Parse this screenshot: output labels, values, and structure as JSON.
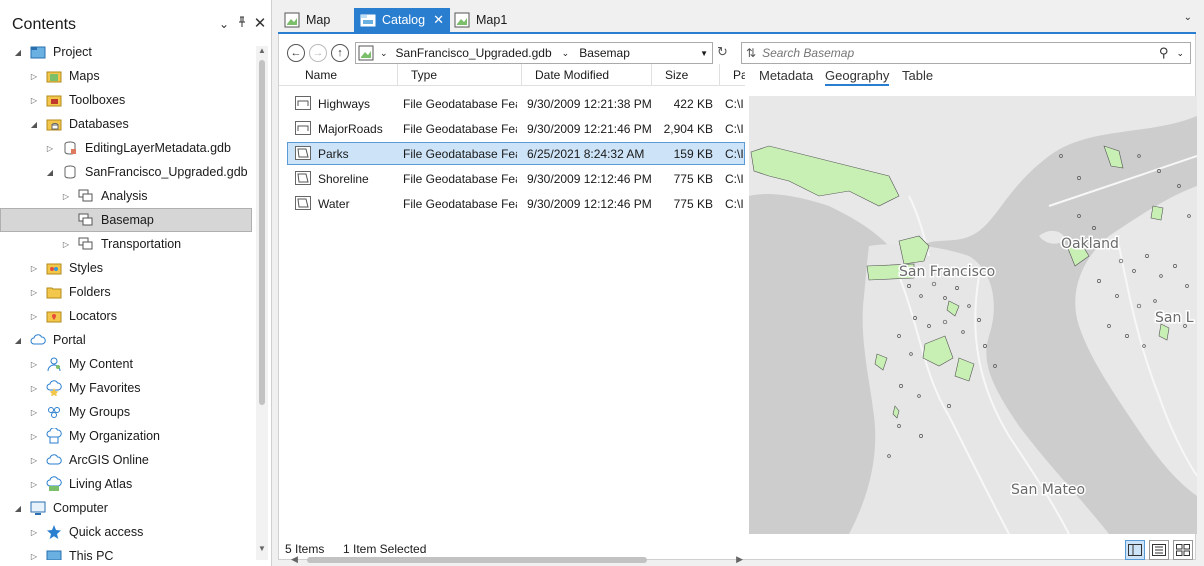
{
  "contents": {
    "title": "Contents",
    "items": [
      {
        "label": "Project",
        "icon": "project-icon"
      },
      {
        "label": "Maps",
        "icon": "maps-folder-icon"
      },
      {
        "label": "Toolboxes",
        "icon": "toolbox-icon"
      },
      {
        "label": "Databases",
        "icon": "database-folder-icon"
      },
      {
        "label": "EditingLayerMetadata.gdb",
        "icon": "geodatabase-icon"
      },
      {
        "label": "SanFrancisco_Upgraded.gdb",
        "icon": "geodatabase-icon"
      },
      {
        "label": "Analysis",
        "icon": "feature-dataset-icon"
      },
      {
        "label": "Basemap",
        "icon": "feature-dataset-icon"
      },
      {
        "label": "Transportation",
        "icon": "feature-dataset-icon"
      },
      {
        "label": "Styles",
        "icon": "styles-icon"
      },
      {
        "label": "Folders",
        "icon": "folder-icon"
      },
      {
        "label": "Locators",
        "icon": "locator-icon"
      },
      {
        "label": "Portal",
        "icon": "cloud-icon"
      },
      {
        "label": "My Content",
        "icon": "my-content-icon"
      },
      {
        "label": "My Favorites",
        "icon": "star-icon"
      },
      {
        "label": "My Groups",
        "icon": "groups-icon"
      },
      {
        "label": "My Organization",
        "icon": "organization-icon"
      },
      {
        "label": "ArcGIS Online",
        "icon": "cloud-icon"
      },
      {
        "label": "Living Atlas",
        "icon": "living-atlas-icon"
      },
      {
        "label": "Computer",
        "icon": "computer-icon"
      },
      {
        "label": "Quick access",
        "icon": "pin-star-icon"
      },
      {
        "label": "This PC",
        "icon": "this-pc-icon"
      }
    ]
  },
  "tabs": [
    {
      "label": "Map"
    },
    {
      "label": "Catalog"
    },
    {
      "label": "Map1"
    }
  ],
  "catalog": {
    "path": {
      "gdb": "SanFrancisco_Upgraded.gdb",
      "dataset": "Basemap"
    },
    "search_placeholder": "Search Basemap",
    "columns": [
      "Name",
      "Type",
      "Date Modified",
      "Size",
      "Pa"
    ],
    "rows": [
      {
        "name": "Highways",
        "type": "File Geodatabase Feat",
        "date": "9/30/2009 12:21:38 PM",
        "size": "422 KB",
        "path": "C:\\I",
        "icon": "line-feature-class-icon"
      },
      {
        "name": "MajorRoads",
        "type": "File Geodatabase Feat",
        "date": "9/30/2009 12:21:46 PM",
        "size": "2,904 KB",
        "path": "C:\\I",
        "icon": "line-feature-class-icon"
      },
      {
        "name": "Parks",
        "type": "File Geodatabase Feat",
        "date": "6/25/2021 8:24:32 AM",
        "size": "159 KB",
        "path": "C:\\I",
        "icon": "polygon-feature-class-icon"
      },
      {
        "name": "Shoreline",
        "type": "File Geodatabase Feat",
        "date": "9/30/2009 12:12:46 PM",
        "size": "775 KB",
        "path": "C:\\I",
        "icon": "polygon-feature-class-icon"
      },
      {
        "name": "Water",
        "type": "File Geodatabase Feat",
        "date": "9/30/2009 12:12:46 PM",
        "size": "775 KB",
        "path": "C:\\I",
        "icon": "polygon-feature-class-icon"
      }
    ],
    "status": {
      "items": "5 Items",
      "selected": "1 Item Selected"
    },
    "preview_tabs": [
      "Metadata",
      "Geography",
      "Table"
    ],
    "map_labels": {
      "sf": "San Francisco",
      "oakland": "Oakland",
      "san_mateo": "San Mateo",
      "san_l": "San L"
    }
  },
  "colors": {
    "accent": "#2a7ecf",
    "selection": "#cde3f7",
    "park_fill": "#c8f0b4",
    "land": "#eaeaea",
    "water": "#cfcfcf"
  }
}
